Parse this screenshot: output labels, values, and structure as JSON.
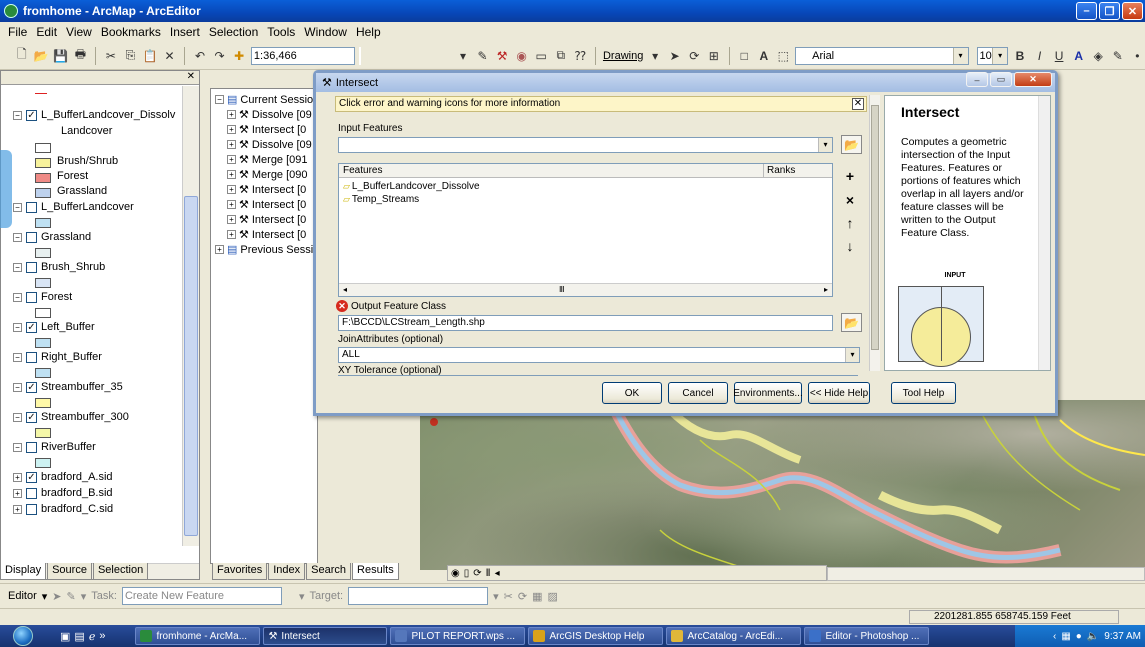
{
  "window": {
    "title": "fromhome - ArcMap - ArcEditor"
  },
  "menu": [
    "File",
    "Edit",
    "View",
    "Bookmarks",
    "Insert",
    "Selection",
    "Tools",
    "Window",
    "Help"
  ],
  "toolbar": {
    "scale": "1:36,466",
    "drawing_label": "Drawing",
    "font_name": "Arial",
    "font_size": "10"
  },
  "toc": {
    "layers": [
      {
        "name": "L_BufferLandcover_Dissolv",
        "checked": true
      },
      {
        "name": "Landcover",
        "legend": true
      },
      {
        "name": "Brush/Shrub",
        "legend": true
      },
      {
        "name": "Forest",
        "legend": true
      },
      {
        "name": "Grassland",
        "legend": true
      },
      {
        "name": "L_BufferLandcover",
        "checked": false
      },
      {
        "name": "Grassland",
        "checked": false
      },
      {
        "name": "Brush_Shrub",
        "checked": false
      },
      {
        "name": "Forest",
        "checked": false
      },
      {
        "name": "Left_Buffer",
        "checked": true
      },
      {
        "name": "Right_Buffer",
        "checked": false
      },
      {
        "name": "Streambuffer_35",
        "checked": true
      },
      {
        "name": "Streambuffer_300",
        "checked": true
      },
      {
        "name": "RiverBuffer",
        "checked": false
      },
      {
        "name": "bradford_A.sid",
        "checked": true
      },
      {
        "name": "bradford_B.sid",
        "checked": false
      },
      {
        "name": "bradford_C.sid",
        "checked": false
      }
    ],
    "tabs": [
      "Display",
      "Source",
      "Selection"
    ]
  },
  "results": {
    "root": "Current Session",
    "items": [
      "Dissolve [09",
      "Intersect [0",
      "Dissolve [09",
      "Merge [091",
      "Merge [090",
      "Intersect [0",
      "Intersect [0",
      "Intersect [0",
      "Intersect [0"
    ],
    "previous": "Previous Sessio",
    "tabs": [
      "Favorites",
      "Index",
      "Search",
      "Results"
    ]
  },
  "dialog": {
    "title": "Intersect",
    "message": "Click error and warning icons for more information",
    "input_label": "Input Features",
    "input_value": "",
    "list_header_features": "Features",
    "list_header_ranks": "Ranks",
    "features": [
      "L_BufferLandcover_Dissolve",
      "Temp_Streams"
    ],
    "output_label": "Output Feature Class",
    "output_value": "F:\\BCCD\\LCStream_Length.shp",
    "join_label": "JoinAttributes (optional)",
    "join_value": "ALL",
    "xy_label": "XY Tolerance (optional)",
    "buttons": {
      "ok": "OK",
      "cancel": "Cancel",
      "env": "Environments...",
      "hide": "<< Hide Help",
      "toolhelp": "Tool Help"
    },
    "help": {
      "title": "Intersect",
      "text": "Computes a geometric intersection of the Input Features. Features or portions of features which overlap in all layers and/or feature classes will be written to the Output Feature Class.",
      "diagram_label": "INPUT"
    }
  },
  "editor": {
    "label": "Editor",
    "task_label": "Task:",
    "task_value": "Create New Feature",
    "target_label": "Target:"
  },
  "status": {
    "coords": "2201281.855  658745.159 Feet"
  },
  "taskbar": {
    "items": [
      "fromhome - ArcMa...",
      "Intersect",
      "PILOT REPORT.wps ...",
      "ArcGIS Desktop Help",
      "ArcCatalog - ArcEdi...",
      "Editor - Photoshop ..."
    ],
    "time": "9:37 AM"
  }
}
